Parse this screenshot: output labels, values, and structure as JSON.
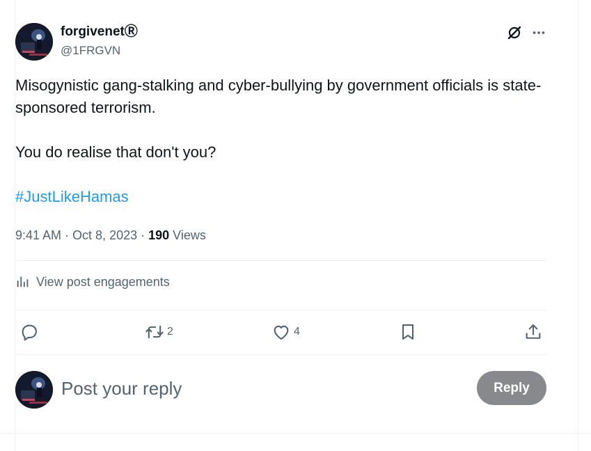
{
  "author": {
    "display_name": "forgivenetⓇ",
    "handle": "@1FRGVN",
    "avatar_icon": "avatar-image"
  },
  "header_actions": {
    "grok_icon": "grok-icon",
    "more_icon": "more-icon"
  },
  "tweet": {
    "paragraph1": "Misogynistic gang-stalking and cyber-bullying by government officials is state-sponsored terrorism.",
    "paragraph2": "You do realise that don't you?",
    "hashtag": "#JustLikeHamas"
  },
  "meta": {
    "time": "9:41 AM",
    "sep1": " · ",
    "date": "Oct 8, 2023",
    "sep2": " · ",
    "views_count": "190",
    "views_label": " Views"
  },
  "engagements": {
    "label": "View post engagements",
    "icon": "analytics-icon"
  },
  "actions": {
    "reply": {
      "icon": "reply-icon",
      "count": ""
    },
    "retweet": {
      "icon": "retweet-icon",
      "count": "2"
    },
    "like": {
      "icon": "heart-icon",
      "count": "4"
    },
    "bookmark": {
      "icon": "bookmark-icon",
      "count": ""
    },
    "share": {
      "icon": "share-icon",
      "count": ""
    }
  },
  "reply_box": {
    "placeholder": "Post your reply",
    "button_label": "Reply"
  },
  "colors": {
    "link": "#1d9bf0",
    "secondary_text": "#536471",
    "reply_button_bg": "#87898c",
    "divider": "#eff3f4"
  }
}
